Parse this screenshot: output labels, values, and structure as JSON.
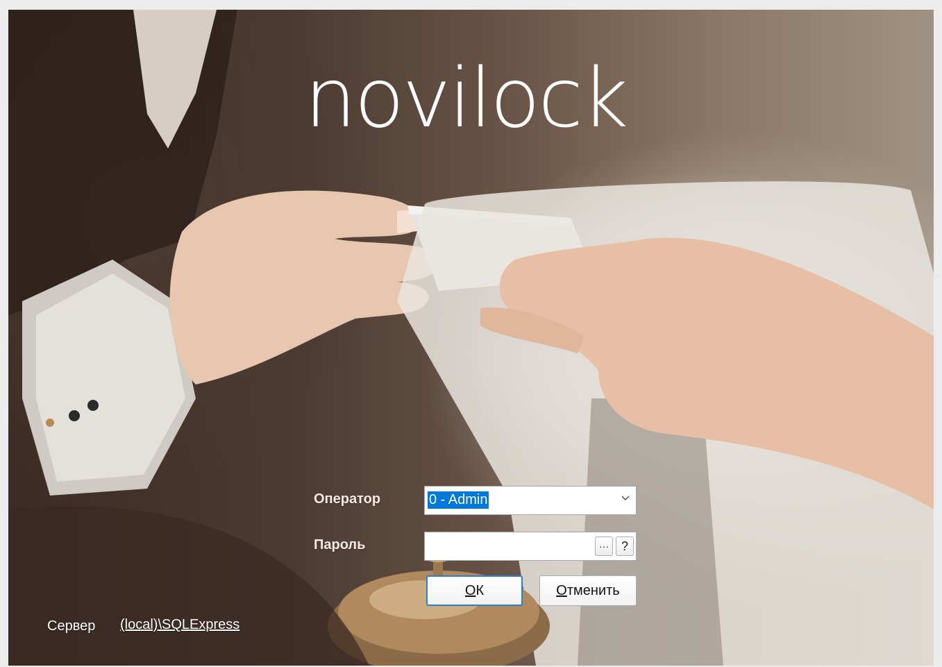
{
  "brand": {
    "logo_text": "novilock"
  },
  "login": {
    "operator_label": "Оператор",
    "operator_value": "0 - Admin",
    "password_label": "Пароль",
    "password_value": "",
    "browse_button": "···",
    "help_button": "?",
    "ok_mnemonic": "О",
    "ok_rest": "К",
    "cancel_mnemonic": "О",
    "cancel_rest": "тменить"
  },
  "server": {
    "label": "Сервер",
    "value": "(local)\\SQLExpress"
  },
  "colors": {
    "selection": "#0078d7",
    "ok_border": "#2a7fd4",
    "label_text": "#f1ebe6"
  }
}
